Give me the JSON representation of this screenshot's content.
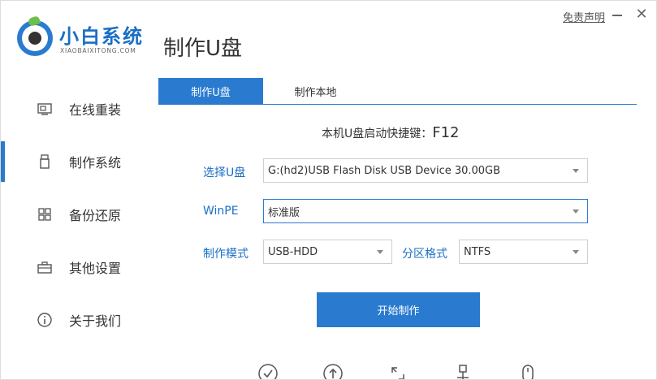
{
  "header": {
    "brand_name": "小白系统",
    "brand_sub": "XIAOBAIXITONG.COM",
    "page_title": "制作U盘",
    "disclaimer": "免责声明",
    "minimize_icon": "minimize-icon",
    "close_glyph": "✕"
  },
  "sidebar": {
    "items": [
      {
        "label": "在线重装",
        "icon": "monitor-icon",
        "active": false
      },
      {
        "label": "制作系统",
        "icon": "usb-drive-icon",
        "active": true
      },
      {
        "label": "备份还原",
        "icon": "grid-icon",
        "active": false
      },
      {
        "label": "其他设置",
        "icon": "toolbox-icon",
        "active": false
      },
      {
        "label": "关于我们",
        "icon": "info-icon",
        "active": false
      }
    ]
  },
  "tabs": [
    {
      "label": "制作U盘",
      "active": true
    },
    {
      "label": "制作本地",
      "active": false
    }
  ],
  "hotkey": {
    "label": "本机U盘启动快捷键：",
    "key": "F12"
  },
  "form": {
    "usb_label": "选择U盘",
    "usb_value": "G:(hd2)USB Flash Disk USB Device 30.00GB",
    "winpe_label": "WinPE",
    "winpe_value": "标准版",
    "mode_label": "制作模式",
    "mode_value": "USB-HDD",
    "partition_label": "分区格式",
    "partition_value": "NTFS"
  },
  "start_button": "开始制作",
  "bottom_icons": [
    "check-circle-icon",
    "upload-circle-icon",
    "refresh-icon",
    "usb-plug-icon",
    "mouse-icon"
  ],
  "colors": {
    "accent": "#2a7bd0",
    "brand_blue": "#1a6fc4",
    "leaf_green": "#6bc04b"
  }
}
